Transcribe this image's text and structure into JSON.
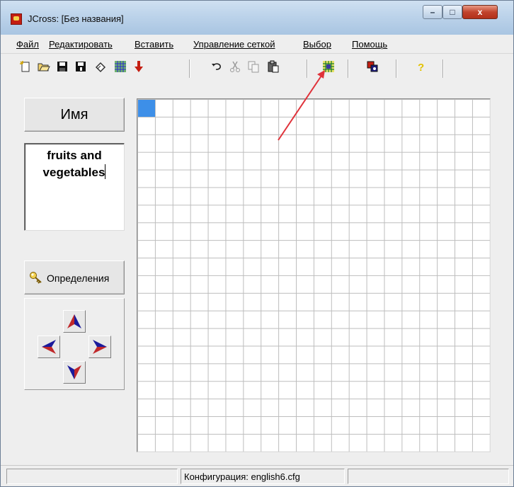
{
  "window": {
    "title": "JCross: [Без названия]"
  },
  "titlebar_buttons": {
    "minimize": "–",
    "maximize": "□",
    "close": "x"
  },
  "menu": [
    "Файл",
    "Редактировать",
    "Вставить",
    "Управление сеткой",
    "Выбор",
    "Помощь"
  ],
  "toolbar": [
    {
      "icon": "new-icon"
    },
    {
      "icon": "open-icon"
    },
    {
      "icon": "save-icon"
    },
    {
      "icon": "save-as-icon"
    },
    {
      "icon": "clear-icon"
    },
    {
      "icon": "grid-pattern-icon"
    },
    {
      "icon": "down-arrow-icon"
    },
    {
      "icon": "undo-icon"
    },
    {
      "icon": "cut-icon",
      "disabled": true
    },
    {
      "icon": "copy-icon",
      "disabled": true
    },
    {
      "icon": "paste-icon"
    },
    {
      "icon": "generate-grid-icon"
    },
    {
      "icon": "colors-icon"
    },
    {
      "icon": "help-icon"
    }
  ],
  "left_panel": {
    "name_button": "Имя",
    "name_value_line1": "fruits and",
    "name_value_line2": "vegetables",
    "definitions_button": "Определения"
  },
  "grid": {
    "columns": 20,
    "rows": 20,
    "selected_cell": [
      1,
      1
    ],
    "selected_color": "#3d8fe8"
  },
  "status": {
    "config": "Конфигурация: english6.cfg"
  },
  "colors": {
    "annotation_arrow": "#e0323a",
    "arrow_blue": "#1a1a9c",
    "arrow_red": "#c0282a"
  }
}
